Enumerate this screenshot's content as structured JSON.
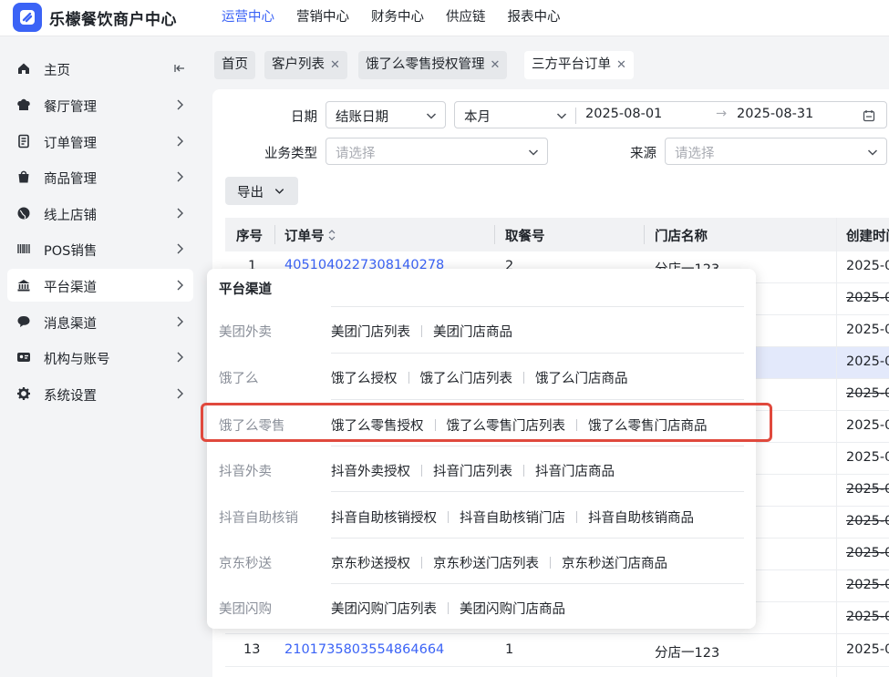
{
  "app": {
    "title": "乐檬餐饮商户中心"
  },
  "topnav": {
    "items": [
      "运营中心",
      "营销中心",
      "财务中心",
      "供应链",
      "报表中心"
    ],
    "active": "运营中心"
  },
  "sidebar": {
    "items": [
      {
        "label": "主页",
        "icon": "home-icon"
      },
      {
        "label": "餐厅管理",
        "icon": "chef-hat-icon"
      },
      {
        "label": "订单管理",
        "icon": "order-icon"
      },
      {
        "label": "商品管理",
        "icon": "bag-icon"
      },
      {
        "label": "线上店铺",
        "icon": "globe-icon"
      },
      {
        "label": "POS销售",
        "icon": "barcode-icon"
      },
      {
        "label": "平台渠道",
        "icon": "bank-icon"
      },
      {
        "label": "消息渠道",
        "icon": "chat-icon"
      },
      {
        "label": "机构与账号",
        "icon": "id-card-icon"
      },
      {
        "label": "系统设置",
        "icon": "gear-icon"
      }
    ]
  },
  "tabs": [
    {
      "label": "首页",
      "closable": false
    },
    {
      "label": "客户列表",
      "closable": true
    },
    {
      "label": "饿了么零售授权管理",
      "closable": true
    },
    {
      "label": "三方平台订单",
      "closable": true,
      "active": true
    }
  ],
  "filters": {
    "date_label": "日期",
    "date_type": "结账日期",
    "date_range_preset": "本月",
    "date_start": "2025-08-01",
    "date_end": "2025-08-31",
    "range_sep": "→",
    "biz_label": "业务类型",
    "biz_placeholder": "请选择",
    "source_label": "来源",
    "source_placeholder": "请选择"
  },
  "export_label": "导出",
  "table": {
    "columns": [
      "序号",
      "订单号",
      "取餐号",
      "门店名称",
      "创建时间"
    ],
    "rows": [
      {
        "no": "1",
        "order": "4051040227308140278",
        "pickup": "2",
        "store": "分店一123",
        "created": "2025-0"
      },
      {
        "no": "",
        "order": "",
        "pickup": "",
        "store": "",
        "created": "2025-0"
      },
      {
        "no": "",
        "order": "",
        "pickup": "",
        "store": "",
        "created": "2025-0"
      },
      {
        "no": "",
        "order": "",
        "pickup": "",
        "store": "",
        "created": "2025-0"
      },
      {
        "no": "",
        "order": "",
        "pickup": "",
        "store": "",
        "created": "2025-0"
      },
      {
        "no": "",
        "order": "",
        "pickup": "",
        "store": "",
        "created": "2025-0"
      },
      {
        "no": "",
        "order": "",
        "pickup": "",
        "store": "",
        "created": "2025-0"
      },
      {
        "no": "",
        "order": "",
        "pickup": "",
        "store": "",
        "created": "2025-0"
      },
      {
        "no": "",
        "order": "",
        "pickup": "",
        "store": "",
        "created": "2025-0"
      },
      {
        "no": "",
        "order": "",
        "pickup": "",
        "store": "",
        "created": "2025-0"
      },
      {
        "no": "",
        "order": "",
        "pickup": "",
        "store": "",
        "created": "2025-0"
      },
      {
        "no": "",
        "order": "",
        "pickup": "",
        "store": "",
        "created": "2025-0"
      },
      {
        "no": "13",
        "order": "2101735803554864664",
        "pickup": "1",
        "store": "分店一123",
        "created": "2025-0"
      }
    ]
  },
  "popup": {
    "title": "平台渠道",
    "groups": [
      {
        "category": "美团外卖",
        "links": [
          "美团门店列表",
          "美团门店商品"
        ]
      },
      {
        "category": "饿了么",
        "links": [
          "饿了么授权",
          "饿了么门店列表",
          "饿了么门店商品"
        ]
      },
      {
        "category": "饿了么零售",
        "links": [
          "饿了么零售授权",
          "饿了么零售门店列表",
          "饿了么零售门店商品"
        ]
      },
      {
        "category": "抖音外卖",
        "links": [
          "抖音外卖授权",
          "抖音门店列表",
          "抖音门店商品"
        ]
      },
      {
        "category": "抖音自助核销",
        "links": [
          "抖音自助核销授权",
          "抖音自助核销门店",
          "抖音自助核销商品"
        ]
      },
      {
        "category": "京东秒送",
        "links": [
          "京东秒送授权",
          "京东秒送门店列表",
          "京东秒送门店商品"
        ]
      },
      {
        "category": "美团闪购",
        "links": [
          "美团闪购门店列表",
          "美团闪购门店商品"
        ]
      }
    ]
  },
  "colors": {
    "accent": "#3b63f6",
    "highlight": "#e0493d"
  }
}
